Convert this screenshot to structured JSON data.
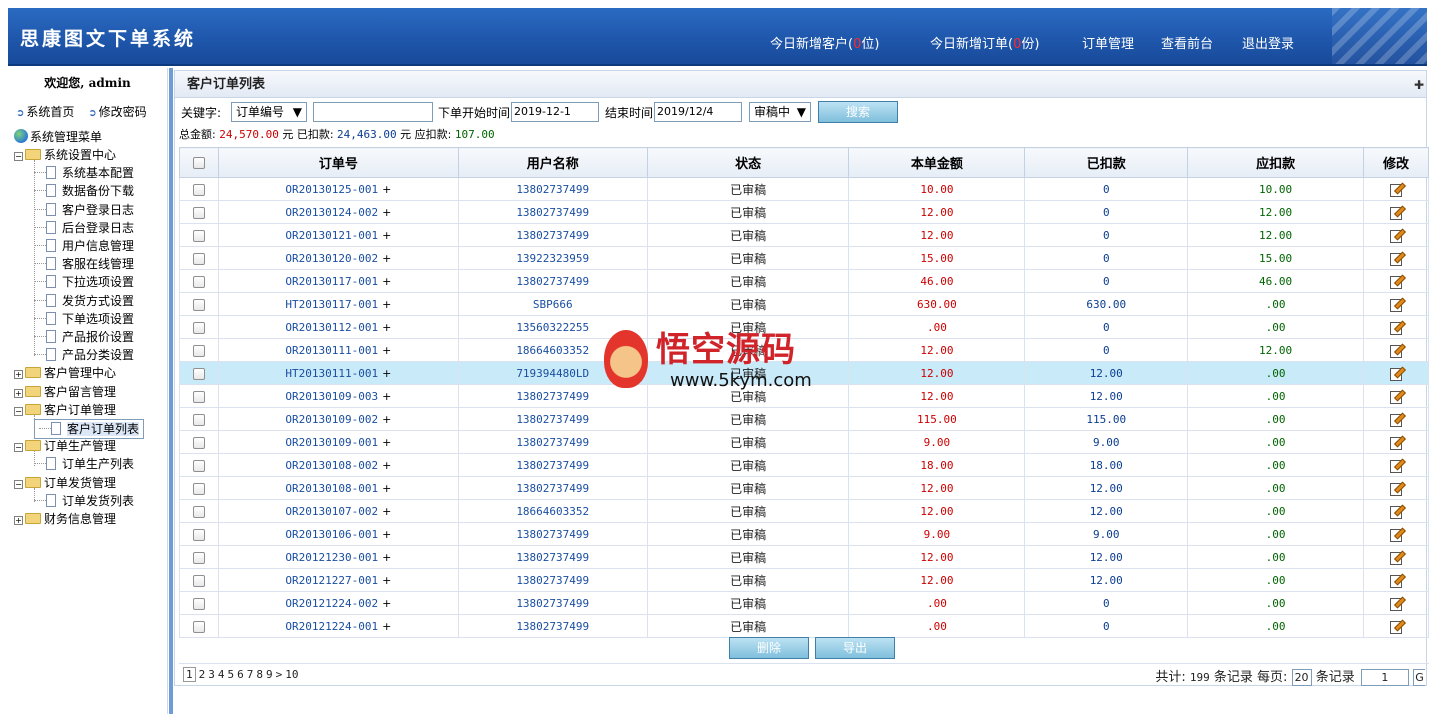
{
  "header": {
    "app_title": "思康图文下单系统",
    "nav": {
      "new_customers_prefix": "今日新增客户(",
      "new_customers_count": "0",
      "new_customers_suffix": "位)",
      "new_orders_prefix": "今日新增订单(",
      "new_orders_count": "0",
      "new_orders_suffix": "份)",
      "order_mgmt": "订单管理",
      "view_frontend": "查看前台",
      "logout": "退出登录"
    }
  },
  "sidebar": {
    "welcome": "欢迎您, admin",
    "home": "系统首页",
    "change_password": "修改密码",
    "menu_root": "系统管理菜单",
    "groups": [
      {
        "label": "系统设置中心",
        "expanded": true,
        "items": [
          "系统基本配置",
          "数据备份下载",
          "客户登录日志",
          "后台登录日志",
          "用户信息管理",
          "客服在线管理",
          "下拉选项设置",
          "发货方式设置",
          "下单选项设置",
          "产品报价设置",
          "产品分类设置"
        ]
      },
      {
        "label": "客户管理中心",
        "expanded": false,
        "items": []
      },
      {
        "label": "客户留言管理",
        "expanded": false,
        "items": []
      },
      {
        "label": "客户订单管理",
        "expanded": true,
        "items": [
          "客户订单列表"
        ]
      },
      {
        "label": "订单生产管理",
        "expanded": true,
        "items": [
          "订单生产列表"
        ]
      },
      {
        "label": "订单发货管理",
        "expanded": true,
        "items": [
          "订单发货列表"
        ]
      },
      {
        "label": "财务信息管理",
        "expanded": false,
        "items": []
      }
    ],
    "selected_item": "客户订单列表"
  },
  "main": {
    "panel_title": "客户订单列表",
    "search": {
      "keyword_label": "关键字:",
      "field_select": "订单编号",
      "keyword_value": "",
      "start_label": "下单开始时间",
      "start_value": "2019-12-1",
      "end_label": "结束时间",
      "end_value": "2019/12/4",
      "status_select": "审稿中",
      "search_button": "搜索"
    },
    "totals": {
      "total_label": "总金额:",
      "total_value": "24,570.00",
      "deducted_label": "元 已扣款:",
      "deducted_value": "24,463.00",
      "due_label": "元 应扣款:",
      "due_value": "107.00"
    },
    "columns": [
      "订单号",
      "用户名称",
      "状态",
      "本单金额",
      "已扣款",
      "应扣款",
      "修改"
    ],
    "rows": [
      {
        "order": "OR20130125-001",
        "user": "13802737499",
        "status": "已审稿",
        "amount": "10.00",
        "paid": "0",
        "due": "10.00"
      },
      {
        "order": "OR20130124-002",
        "user": "13802737499",
        "status": "已审稿",
        "amount": "12.00",
        "paid": "0",
        "due": "12.00"
      },
      {
        "order": "OR20130121-001",
        "user": "13802737499",
        "status": "已审稿",
        "amount": "12.00",
        "paid": "0",
        "due": "12.00"
      },
      {
        "order": "OR20130120-002",
        "user": "13922323959",
        "status": "已审稿",
        "amount": "15.00",
        "paid": "0",
        "due": "15.00"
      },
      {
        "order": "OR20130117-001",
        "user": "13802737499",
        "status": "已审稿",
        "amount": "46.00",
        "paid": "0",
        "due": "46.00"
      },
      {
        "order": "HT20130117-001",
        "user": "SBP666",
        "status": "已审稿",
        "amount": "630.00",
        "paid": "630.00",
        "due": ".00"
      },
      {
        "order": "OR20130112-001",
        "user": "13560322255",
        "status": "已审稿",
        "amount": ".00",
        "paid": "0",
        "due": ".00"
      },
      {
        "order": "OR20130111-001",
        "user": "18664603352",
        "status": "已审稿",
        "amount": "12.00",
        "paid": "0",
        "due": "12.00"
      },
      {
        "order": "HT20130111-001",
        "user": "719394480LD",
        "status": "已审稿",
        "amount": "12.00",
        "paid": "12.00",
        "due": ".00"
      },
      {
        "order": "OR20130109-003",
        "user": "13802737499",
        "status": "已审稿",
        "amount": "12.00",
        "paid": "12.00",
        "due": ".00"
      },
      {
        "order": "OR20130109-002",
        "user": "13802737499",
        "status": "已审稿",
        "amount": "115.00",
        "paid": "115.00",
        "due": ".00"
      },
      {
        "order": "OR20130109-001",
        "user": "13802737499",
        "status": "已审稿",
        "amount": "9.00",
        "paid": "9.00",
        "due": ".00"
      },
      {
        "order": "OR20130108-002",
        "user": "13802737499",
        "status": "已审稿",
        "amount": "18.00",
        "paid": "18.00",
        "due": ".00"
      },
      {
        "order": "OR20130108-001",
        "user": "13802737499",
        "status": "已审稿",
        "amount": "12.00",
        "paid": "12.00",
        "due": ".00"
      },
      {
        "order": "OR20130107-002",
        "user": "18664603352",
        "status": "已审稿",
        "amount": "12.00",
        "paid": "12.00",
        "due": ".00"
      },
      {
        "order": "OR20130106-001",
        "user": "13802737499",
        "status": "已审稿",
        "amount": "9.00",
        "paid": "9.00",
        "due": ".00"
      },
      {
        "order": "OR20121230-001",
        "user": "13802737499",
        "status": "已审稿",
        "amount": "12.00",
        "paid": "12.00",
        "due": ".00"
      },
      {
        "order": "OR20121227-001",
        "user": "13802737499",
        "status": "已审稿",
        "amount": "12.00",
        "paid": "12.00",
        "due": ".00"
      },
      {
        "order": "OR20121224-002",
        "user": "13802737499",
        "status": "已审稿",
        "amount": ".00",
        "paid": "0",
        "due": ".00"
      },
      {
        "order": "OR20121224-001",
        "user": "13802737499",
        "status": "已审稿",
        "amount": ".00",
        "paid": "0",
        "due": ".00"
      }
    ],
    "highlighted_row": 8,
    "actions": {
      "delete": "删除",
      "export": "导出"
    },
    "pager": {
      "pages": [
        "1",
        "2",
        "3",
        "4",
        "5",
        "6",
        "7",
        "8",
        "9",
        ">",
        "10"
      ],
      "total_label": "共计:",
      "total_count": "199",
      "records_label": "条记录",
      "per_page_label": "每页:",
      "per_page_value": "20",
      "records_label2": "条记录",
      "goto_value": "1",
      "go_label": "G"
    }
  },
  "watermark": {
    "title": "悟空源码",
    "url": "www.5kym.com"
  },
  "colors": {
    "header_blue": "#1f57ac",
    "amount_red": "#cc0000",
    "paid_blue": "#0b3d91",
    "due_green": "#006400",
    "highlight": "#c9eaf8"
  }
}
